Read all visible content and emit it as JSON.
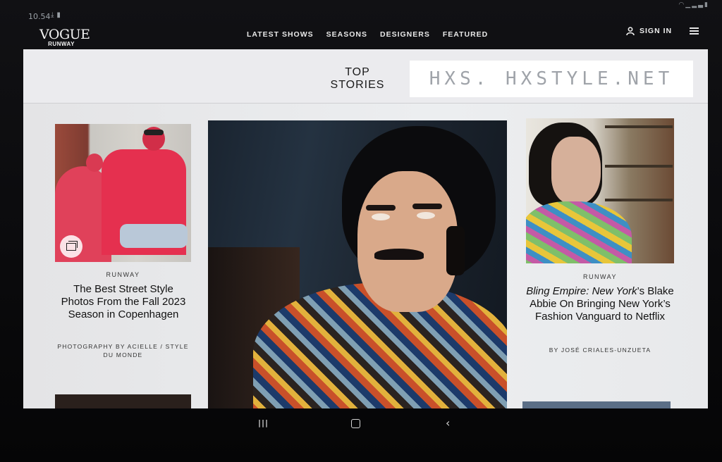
{
  "status_bar": {
    "time": "10.54",
    "icons": [
      "download-icon",
      "sim-icon"
    ],
    "right_icons": [
      "wifi-icon",
      "signal-icon",
      "battery-icon"
    ]
  },
  "header": {
    "logo_wordmark": "VOGUE",
    "logo_subtitle": "RUNWAY",
    "nav": [
      "LATEST SHOWS",
      "SEASONS",
      "DESIGNERS",
      "FEATURED"
    ],
    "sign_in": "SIGN IN"
  },
  "section": {
    "title_line1": "TOP",
    "title_line2": "STORIES",
    "watermark": "HXS. HXSTYLE.NET"
  },
  "stories": {
    "left": {
      "kicker": "RUNWAY",
      "headline": "The Best Street Style Photos From the Fall 2023 Season in Copenhagen",
      "byline": "PHOTOGRAPHY BY ACIELLE / STYLE DU MONDE",
      "badge_icon": "gallery-icon"
    },
    "right": {
      "kicker": "RUNWAY",
      "headline_italic": "Bling Empire: New York",
      "headline_rest": "’s Blake Abbie On Bringing New York’s Fashion Vanguard to Netflix",
      "byline": "BY JOSÉ CRIALES-UNZUETA"
    }
  },
  "system_nav": {
    "recents": "|||",
    "back": "‹"
  },
  "colors": {
    "header_bg": "#0d0d0f",
    "panel_bg": "#e8e9eb",
    "text": "#111111"
  }
}
